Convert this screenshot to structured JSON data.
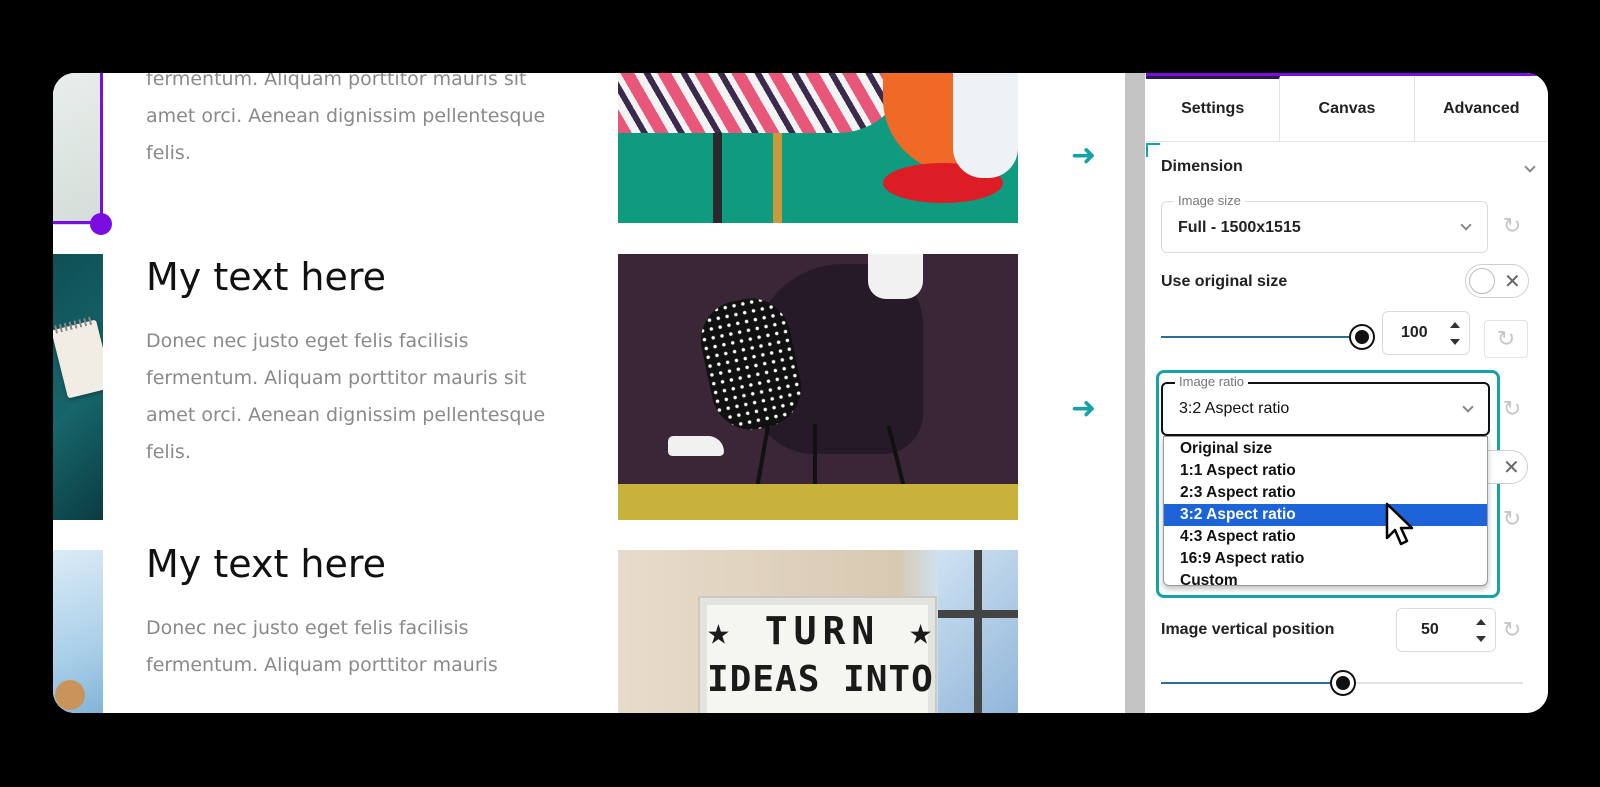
{
  "content": {
    "blocks": [
      {
        "body": "fermentum. Aliquam porttitor mauris sit amet orci. Aenean dignissim pellentesque felis."
      },
      {
        "heading": "My text here",
        "body": "Donec nec justo eget felis facilisis fermentum. Aliquam porttitor mauris sit amet orci. Aenean dignissim pellentesque felis."
      },
      {
        "heading": "My text here",
        "body": "Donec nec justo eget felis facilisis fermentum. Aliquam porttitor mauris"
      }
    ],
    "lightbox": {
      "line1": "★ TURN ★",
      "line2": "IDEAS INTO"
    },
    "arrow_glyph": "➜"
  },
  "panel": {
    "tabs": [
      {
        "label": "Settings",
        "active": true
      },
      {
        "label": "Canvas",
        "active": false
      },
      {
        "label": "Advanced",
        "active": false
      }
    ],
    "section": "Dimension",
    "image_size": {
      "label": "Image size",
      "value": "Full - 1500x1515"
    },
    "use_original_size": {
      "label": "Use original size",
      "checked": false,
      "off_glyph": "✕"
    },
    "scale": {
      "value": "100",
      "fraction": 1.0
    },
    "image_ratio": {
      "label": "Image ratio",
      "value": "3:2 Aspect ratio",
      "options": [
        "Original size",
        "1:1 Aspect ratio",
        "2:3 Aspect ratio",
        "3:2 Aspect ratio",
        "4:3 Aspect ratio",
        "16:9 Aspect ratio",
        "Custom"
      ],
      "selected_index": 3
    },
    "vertical_position": {
      "label": "Image vertical position",
      "value": "50",
      "fraction": 0.5
    },
    "reset_glyph": "↻",
    "colors": {
      "accent": "#7a0de0",
      "teal": "#17a2a6",
      "select_blue": "#1d64d8"
    }
  }
}
